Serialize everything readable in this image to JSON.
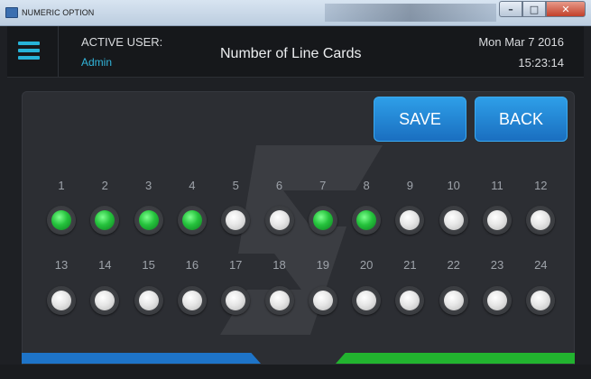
{
  "window": {
    "title": "NUMERIC OPTION",
    "controls": {
      "minimize": "–",
      "maximize": "□",
      "close": "✕"
    }
  },
  "header": {
    "active_user_label": "ACTIVE USER:",
    "active_user": "Admin",
    "title": "Number of Line Cards",
    "date": "Mon Mar 7 2016",
    "time": "15:23:14"
  },
  "buttons": {
    "save": "SAVE",
    "back": "BACK"
  },
  "cards": [
    {
      "label": "1",
      "on": true
    },
    {
      "label": "2",
      "on": true
    },
    {
      "label": "3",
      "on": true
    },
    {
      "label": "4",
      "on": true
    },
    {
      "label": "5",
      "on": false
    },
    {
      "label": "6",
      "on": false
    },
    {
      "label": "7",
      "on": true
    },
    {
      "label": "8",
      "on": true
    },
    {
      "label": "9",
      "on": false
    },
    {
      "label": "10",
      "on": false
    },
    {
      "label": "11",
      "on": false
    },
    {
      "label": "12",
      "on": false
    },
    {
      "label": "13",
      "on": false
    },
    {
      "label": "14",
      "on": false
    },
    {
      "label": "15",
      "on": false
    },
    {
      "label": "16",
      "on": false
    },
    {
      "label": "17",
      "on": false
    },
    {
      "label": "18",
      "on": false
    },
    {
      "label": "19",
      "on": false
    },
    {
      "label": "20",
      "on": false
    },
    {
      "label": "21",
      "on": false
    },
    {
      "label": "22",
      "on": false
    },
    {
      "label": "23",
      "on": false
    },
    {
      "label": "24",
      "on": false
    }
  ],
  "colors": {
    "accent": "#27b3d8",
    "led_on": "#25c23c",
    "button": "#1a6fc0",
    "bar_left": "#1e74c8",
    "bar_right": "#22b32f"
  },
  "icons": {
    "menu": "hamburger-icon",
    "app": "app-icon"
  }
}
